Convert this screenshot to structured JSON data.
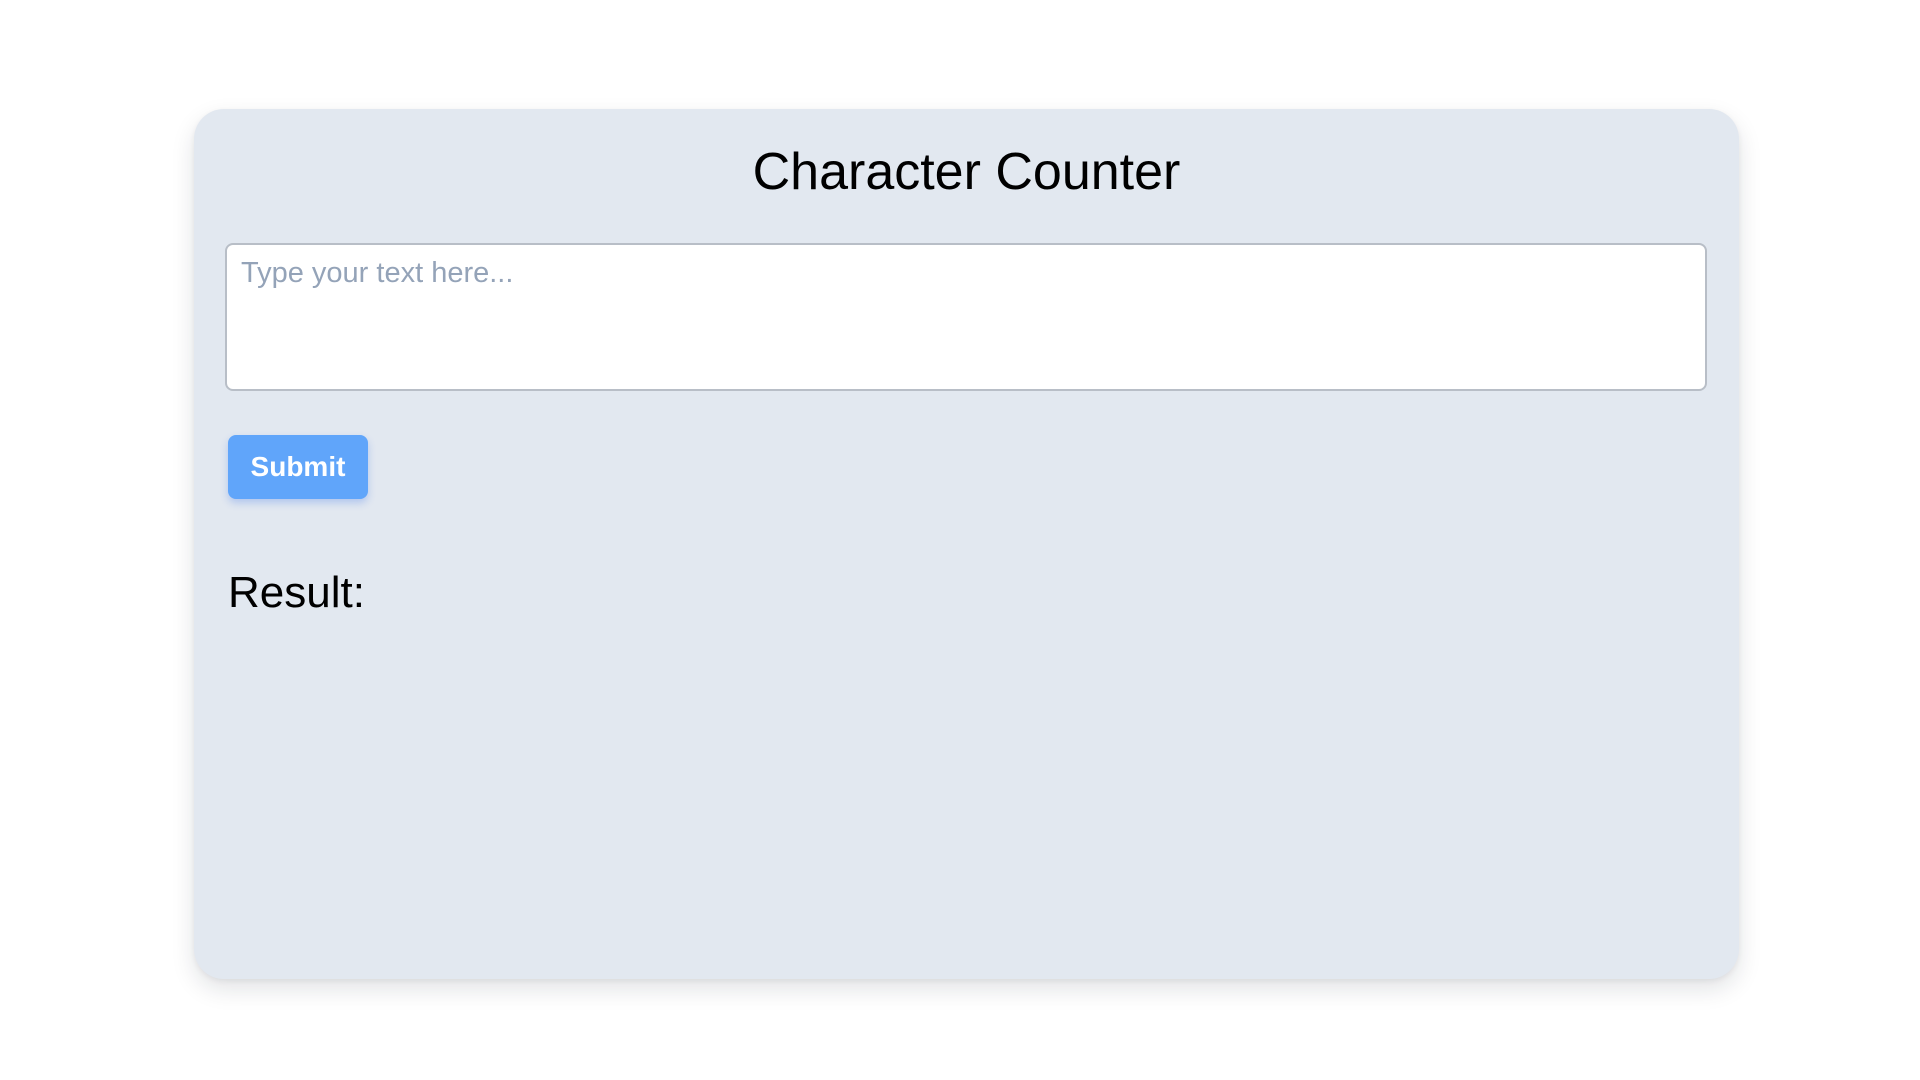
{
  "app": {
    "title": "Character Counter"
  },
  "form": {
    "text_input": {
      "value": "",
      "placeholder": "Type your text here..."
    },
    "submit_label": "Submit"
  },
  "result": {
    "label": "Result:"
  },
  "colors": {
    "page_background": "#ffffff",
    "card_background": "#e2e8f0",
    "button_background": "#60a5fa",
    "button_text": "#ffffff",
    "placeholder_text": "#94a3b8"
  }
}
